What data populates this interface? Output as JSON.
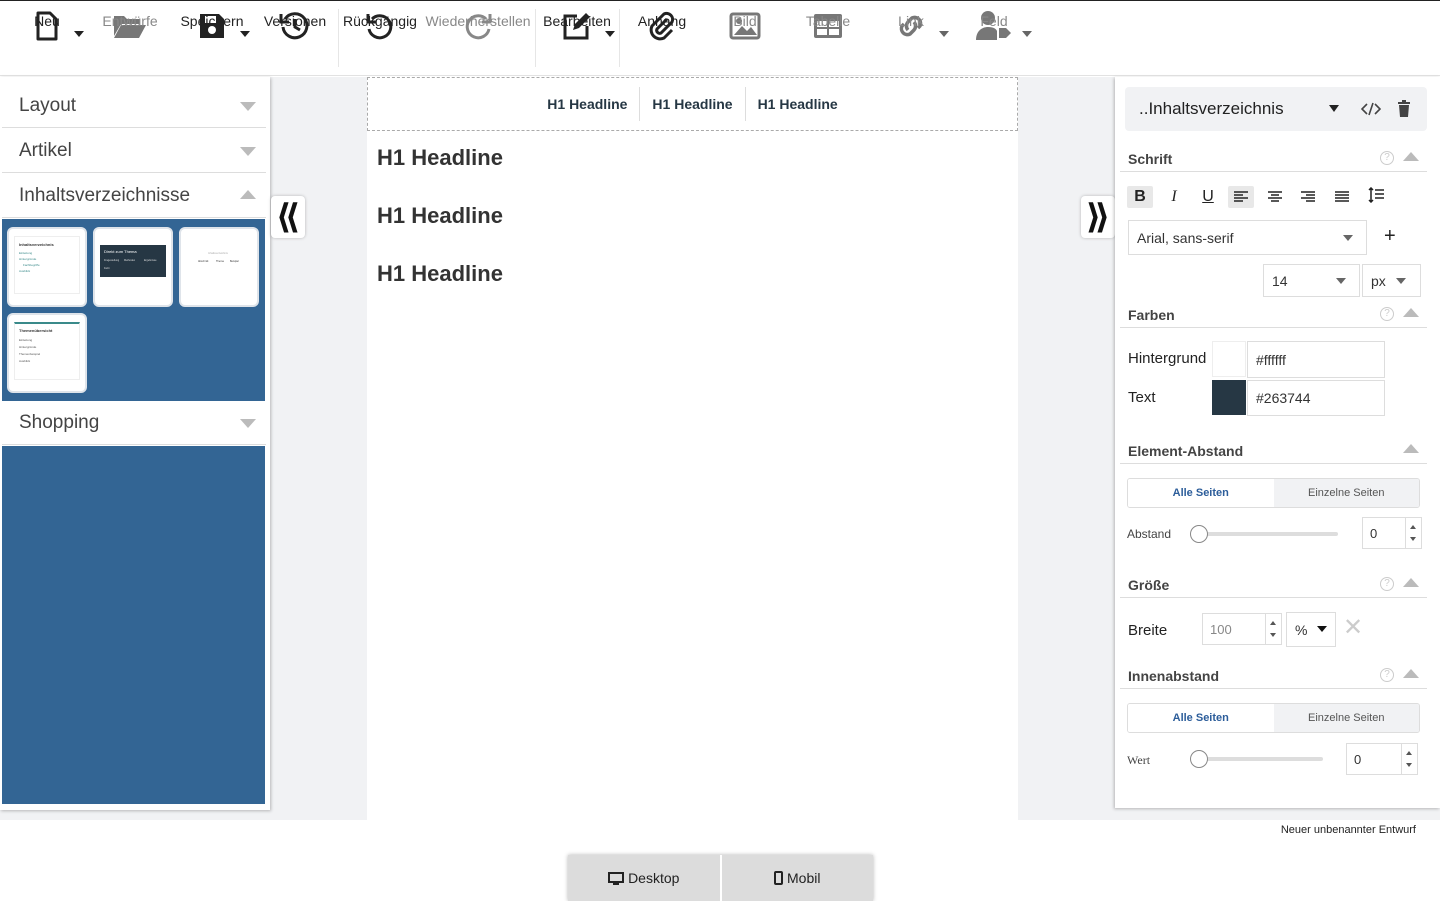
{
  "toolbar": {
    "new": "Neu",
    "drafts": "Entwürfe",
    "save": "Speichern",
    "versions": "Versionen",
    "undo": "Rückgängig",
    "redo": "Wiederherstellen",
    "edit": "Bearbeiten",
    "attachment": "Anhang",
    "image": "Bild",
    "table": "Tabelle",
    "link": "Link",
    "field": "Feld"
  },
  "sidebar": {
    "sections": [
      {
        "label": "Layout"
      },
      {
        "label": "Artikel"
      },
      {
        "label": "Inhaltsverzeichnisse"
      },
      {
        "label": "Shopping"
      }
    ],
    "thumbs": [
      {
        "title": "Inhaltsverzeichnis",
        "lines": [
          "Einleitung",
          "Hintergründe",
          "Fachbegriffe",
          "Ausblick"
        ]
      },
      {
        "title": "Direkt zum Thema",
        "lines": [
          "Fragestellung",
          "Methoden",
          "Ergebnisse",
          "Fazit"
        ]
      },
      {
        "title": "Inhaltsverzeichnis",
        "lines": [
          "Abschnitt",
          "Thema",
          "Beispiel"
        ]
      },
      {
        "title": "Themenübersicht",
        "lines": [
          "Einleitung",
          "Hintergründe",
          "Themenbeispiel",
          "Ausblick"
        ]
      }
    ]
  },
  "canvas": {
    "toc_links": [
      "H1 Headline",
      "H1 Headline",
      "H1 Headline"
    ],
    "headlines": [
      "H1 Headline",
      "H1 Headline",
      "H1 Headline"
    ]
  },
  "panel": {
    "element": "..Inhaltsverzeichnis",
    "font_title": "Schrift",
    "font_family": "Arial, sans-serif",
    "font_size": "14",
    "font_unit": "px",
    "colors_title": "Farben",
    "bg_label": "Hintergrund",
    "bg_value": "#ffffff",
    "text_label": "Text",
    "text_value": "#263744",
    "spacing_title": "Element-Abstand",
    "all_sides": "Alle Seiten",
    "single_sides": "Einzelne Seiten",
    "spacing_label": "Abstand",
    "spacing_value": "0",
    "size_title": "Größe",
    "width_label": "Breite",
    "width_value": "100",
    "width_unit": "%",
    "padding_title": "Innenabstand",
    "padding_all": "Alle Seiten",
    "padding_single": "Einzelne Seiten",
    "padding_label": "Wert",
    "padding_value": "0"
  },
  "status": "Neuer unbenannter Entwurf",
  "viewport": {
    "desktop": "Desktop",
    "mobile": "Mobil"
  },
  "colors": {
    "blue": "#336594",
    "text_swatch": "#263744"
  }
}
